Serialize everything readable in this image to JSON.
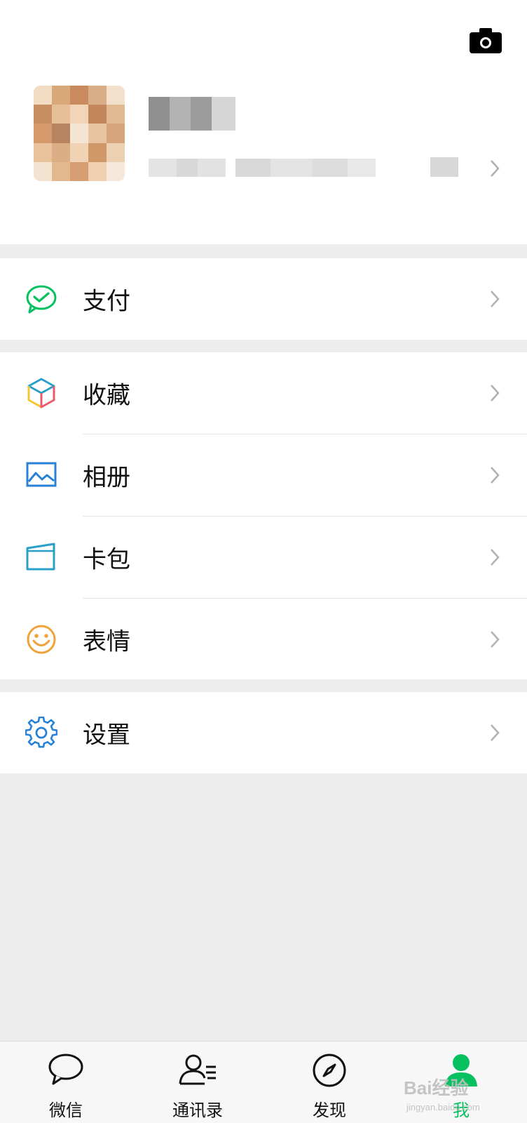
{
  "menu": {
    "pay": "支付",
    "favorites": "收藏",
    "album": "相册",
    "cards": "卡包",
    "stickers": "表情",
    "settings": "设置"
  },
  "tabs": [
    {
      "label": "微信",
      "icon": "chat-bubble-icon",
      "active": false
    },
    {
      "label": "通讯录",
      "icon": "contacts-icon",
      "active": false
    },
    {
      "label": "发现",
      "icon": "compass-icon",
      "active": false
    },
    {
      "label": "我",
      "icon": "me-person-icon",
      "active": true
    }
  ],
  "watermark": {
    "brand": "Bai经验",
    "url": "jingyan.baidu.com"
  },
  "colors": {
    "accent": "#07c160",
    "background": "#ededed",
    "pay_icon": "#07c160",
    "album_icon": "#2782d7",
    "cards_icon": "#2aa0c8",
    "stickers_icon": "#f0a33a",
    "settings_icon": "#2782d7",
    "chevron": "#b2b2b2"
  }
}
